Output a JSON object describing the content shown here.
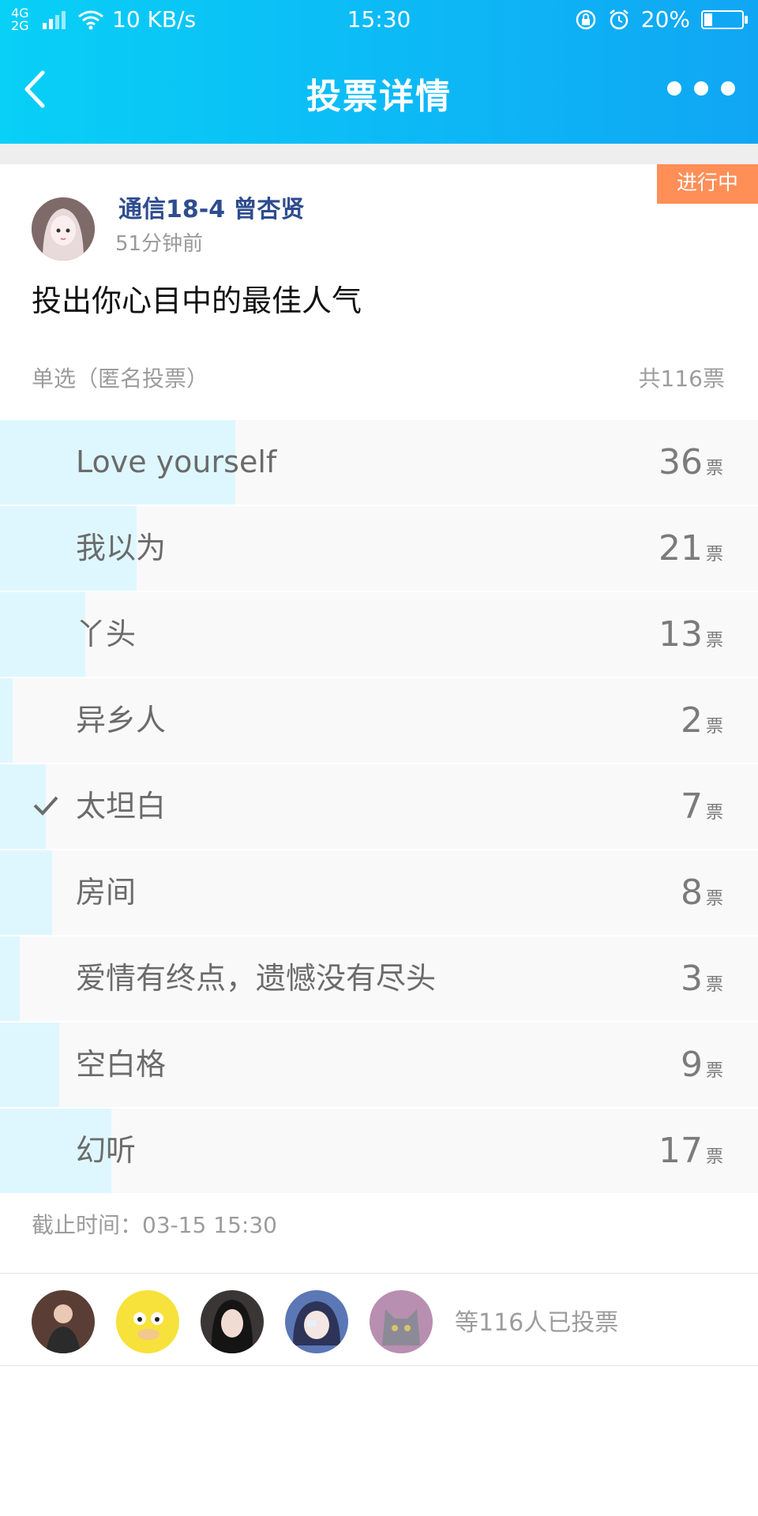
{
  "status_bar": {
    "network": "4G 2G",
    "speed": "10 KB/s",
    "time": "15:30",
    "battery": "20%"
  },
  "header": {
    "title": "投票详情"
  },
  "poll": {
    "status_tag": "进行中",
    "author": "通信18-4 曾杏贤",
    "posted": "51分钟前",
    "question": "投出你心目中的最佳人气",
    "mode": "单选（匿名投票）",
    "total": "共116票",
    "options": [
      {
        "label": "Love yourself",
        "count": "36",
        "unit": "票",
        "share": 0.31,
        "selected": false
      },
      {
        "label": "我以为",
        "count": "21",
        "unit": "票",
        "share": 0.18,
        "selected": false
      },
      {
        "label": "丫头",
        "count": "13",
        "unit": "票",
        "share": 0.112,
        "selected": false
      },
      {
        "label": "异乡人",
        "count": "2",
        "unit": "票",
        "share": 0.017,
        "selected": false
      },
      {
        "label": "太坦白",
        "count": "7",
        "unit": "票",
        "share": 0.06,
        "selected": true
      },
      {
        "label": "房间",
        "count": "8",
        "unit": "票",
        "share": 0.069,
        "selected": false
      },
      {
        "label": "爱情有终点，遗憾没有尽头",
        "count": "3",
        "unit": "票",
        "share": 0.026,
        "selected": false
      },
      {
        "label": "空白格",
        "count": "9",
        "unit": "票",
        "share": 0.078,
        "selected": false
      },
      {
        "label": "幻听",
        "count": "17",
        "unit": "票",
        "share": 0.147,
        "selected": false
      }
    ],
    "deadline": "截止时间：03-15 15:30",
    "voters_text": "等116人已投票"
  },
  "colors": {
    "header_start": "#08d0f7",
    "header_end": "#10a6f4",
    "bar": "#def7fe",
    "tag": "#ff8e57",
    "author": "#2e4c8f"
  }
}
